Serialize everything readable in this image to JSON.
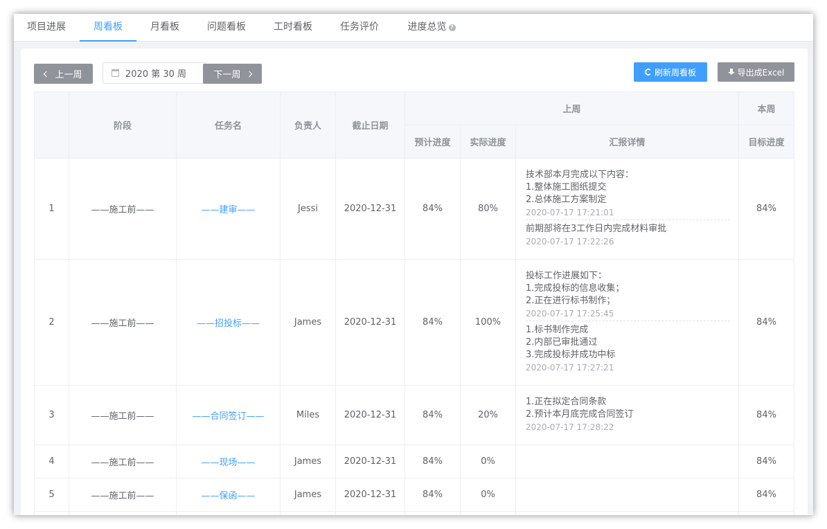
{
  "tabs": [
    {
      "label": "项目进展"
    },
    {
      "label": "周看板",
      "active": true
    },
    {
      "label": "月看板"
    },
    {
      "label": "问题看板"
    },
    {
      "label": "工时看板"
    },
    {
      "label": "任务评价"
    },
    {
      "label": "进度总览",
      "help_icon": "question-circle-icon"
    }
  ],
  "toolbar": {
    "prev_label": "上一周",
    "week_value": "2020 第 30 周",
    "next_label": "下一周",
    "refresh_label": "刷新周看板",
    "export_label": "导出成Excel"
  },
  "table": {
    "headers": {
      "index": "",
      "stage": "阶段",
      "task": "任务名",
      "owner": "负责人",
      "deadline": "截止日期",
      "last_week": "上周",
      "planned": "预计进度",
      "actual": "实际进度",
      "report": "汇报详情",
      "this_week": "本周",
      "target": "目标进度"
    },
    "rows": [
      {
        "index": "1",
        "stage": "——施工前——",
        "task": "——建审——",
        "owner": "Jessi",
        "deadline": "2020-12-31",
        "planned": "84%",
        "actual": "80%",
        "reports": [
          {
            "lines": [
              "技术部本月完成以下内容：",
              "1.整体施工图纸提交",
              "2.总体施工方案制定"
            ],
            "time": "2020-07-17 17:21:01"
          },
          {
            "lines": [
              "前期部将在3工作日内完成材料审批"
            ],
            "time": "2020-07-17 17:22:26"
          }
        ],
        "target": "84%"
      },
      {
        "index": "2",
        "stage": "——施工前——",
        "task": "——招投标——",
        "owner": "James",
        "deadline": "2020-12-31",
        "planned": "84%",
        "actual": "100%",
        "reports": [
          {
            "lines": [
              "投标工作进展如下：",
              "1.完成投标的信息收集；",
              "2.正在进行标书制作；"
            ],
            "time": "2020-07-17 17:25:45"
          },
          {
            "lines": [
              "1.标书制作完成",
              "2.内部已审批通过",
              "3.完成投标并成功中标"
            ],
            "time": "2020-07-17 17:27:21"
          }
        ],
        "target": "84%"
      },
      {
        "index": "3",
        "stage": "——施工前——",
        "task": "——合同签订——",
        "owner": "Miles",
        "deadline": "2020-12-31",
        "planned": "84%",
        "actual": "20%",
        "reports": [
          {
            "lines": [
              "1.正在拟定合同条款",
              "2.预计本月底完成合同签订"
            ],
            "time": "2020-07-17 17:28:22"
          }
        ],
        "target": "84%"
      },
      {
        "index": "4",
        "stage": "——施工前——",
        "task": "——现场——",
        "owner": "James",
        "deadline": "2020-12-31",
        "planned": "84%",
        "actual": "0%",
        "reports": [],
        "target": "84%"
      },
      {
        "index": "5",
        "stage": "——施工前——",
        "task": "——保函——",
        "owner": "James",
        "deadline": "2020-12-31",
        "planned": "84%",
        "actual": "0%",
        "reports": [],
        "target": "84%"
      }
    ]
  }
}
